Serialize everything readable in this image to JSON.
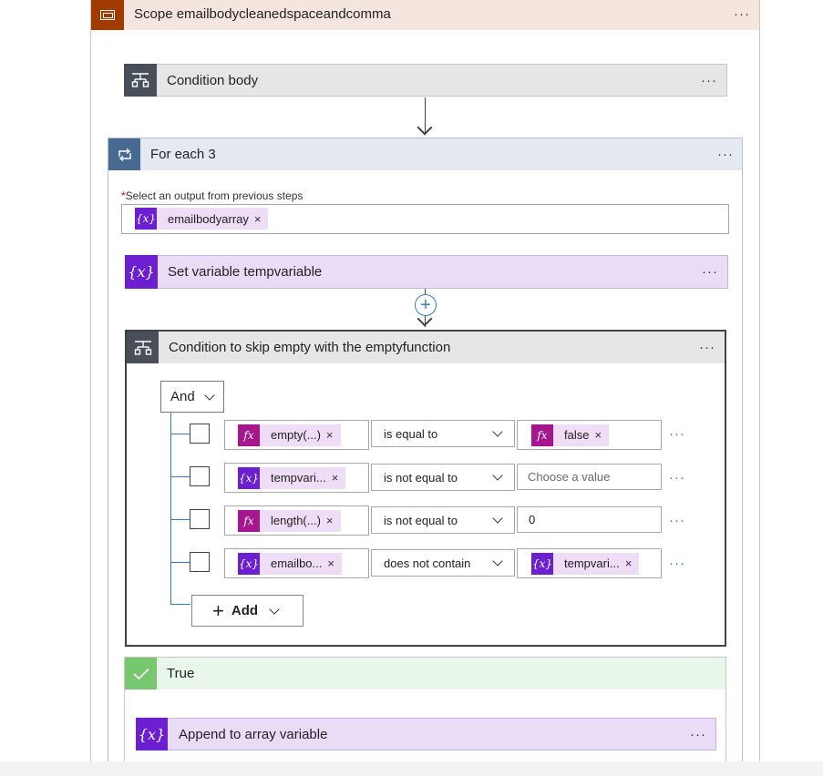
{
  "scope": {
    "title": "Scope emailbodycleanedspaceandcomma",
    "more": "···"
  },
  "condition_body": {
    "title": "Condition body",
    "more": "···"
  },
  "foreach": {
    "title": "For each 3",
    "more": "···",
    "input_label": "Select an output from previous steps",
    "required_mark": "*",
    "token": "emailbodyarray",
    "token_remove": "×"
  },
  "set_variable": {
    "title": "Set variable tempvariable",
    "more": "···"
  },
  "condition": {
    "title": "Condition to skip empty with the emptyfunction",
    "more": "···",
    "group_operator": "And",
    "rows": [
      {
        "left_token": "empty(...)",
        "left_icon": "fx",
        "operator": "is equal to",
        "right_token": "false",
        "right_icon": "fx",
        "right_value": "",
        "right_placeholder": ""
      },
      {
        "left_token": "tempvari...",
        "left_icon": "var",
        "operator": "is not equal to",
        "right_token": "",
        "right_icon": "",
        "right_value": "",
        "right_placeholder": "Choose a value"
      },
      {
        "left_token": "length(...)",
        "left_icon": "fx",
        "operator": "is not equal to",
        "right_token": "",
        "right_icon": "",
        "right_value": "0",
        "right_placeholder": ""
      },
      {
        "left_token": "emailbo...",
        "left_icon": "var",
        "operator": "does not contain",
        "right_token": "tempvari...",
        "right_icon": "var",
        "right_value": "",
        "right_placeholder": ""
      }
    ],
    "row_more": "···",
    "token_remove": "×",
    "add_label": "Add"
  },
  "true_branch": {
    "title": "True"
  },
  "append": {
    "title": "Append to array variable",
    "more": "···"
  },
  "icons": {
    "var_glyph": "{x}",
    "fx_glyph": "fx",
    "plus_glyph": "+",
    "check_glyph": "✓"
  }
}
